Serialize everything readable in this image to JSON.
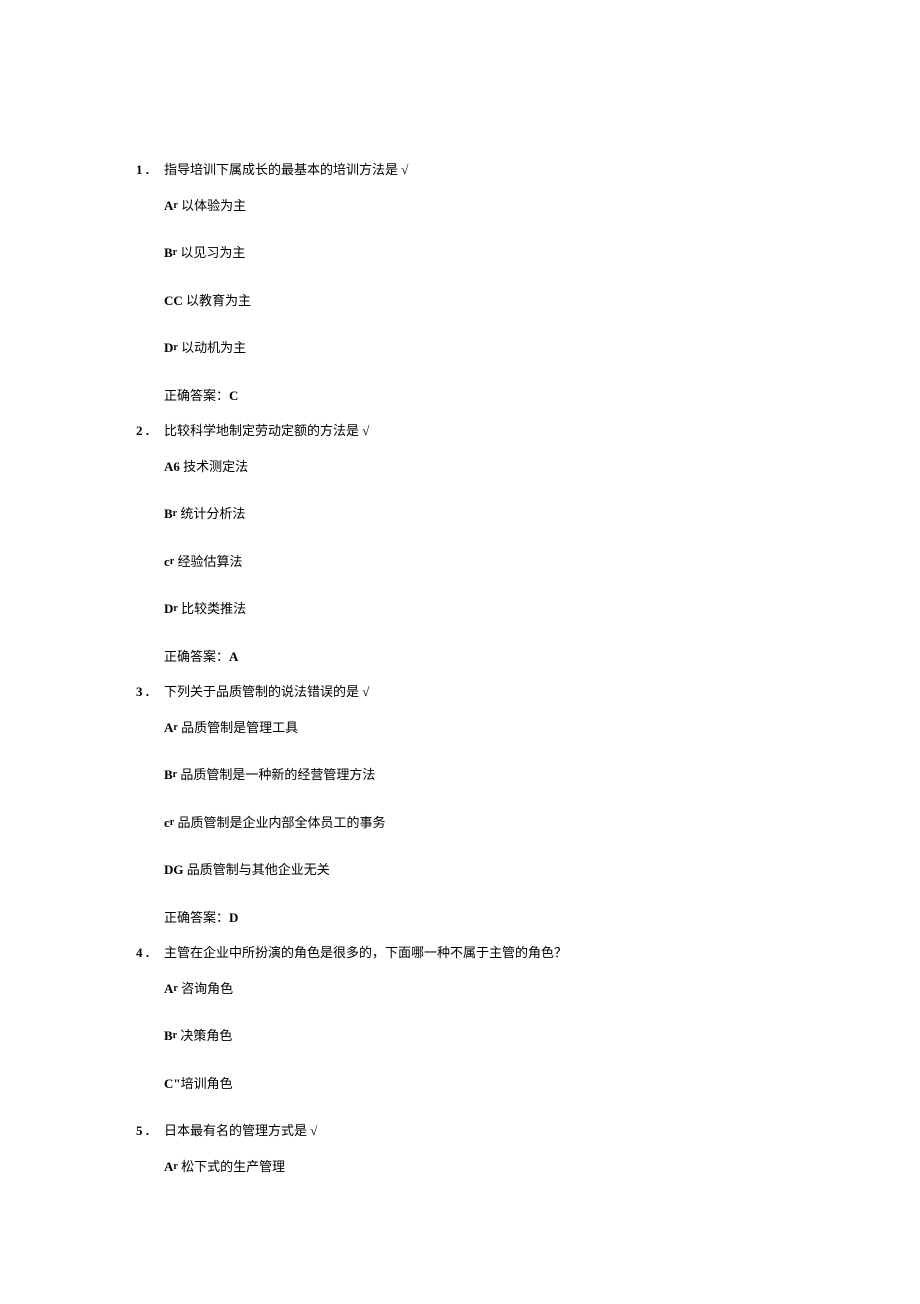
{
  "questions": [
    {
      "num": "1",
      "text": "指导培训下属成长的最基本的培训方法是 √",
      "options": [
        {
          "label": "A",
          "sup": "r",
          "text": " 以体验为主"
        },
        {
          "label": "B",
          "sup": "r",
          "text": " 以见习为主"
        },
        {
          "label": "CC",
          "sup": "",
          "text": " 以教育为主"
        },
        {
          "label": "D",
          "sup": "r",
          "text": " 以动机为主"
        }
      ],
      "answer_label": "正确答案：",
      "answer": "C"
    },
    {
      "num": "2",
      "text": "比较科学地制定劳动定额的方法是 √",
      "options": [
        {
          "label": "A6",
          "sup": "",
          "text": " 技术测定法"
        },
        {
          "label": "B",
          "sup": "r",
          "text": " 统计分析法"
        },
        {
          "label": "c",
          "sup": "r",
          "text": " 经验估算法"
        },
        {
          "label": "D",
          "sup": "r",
          "text": " 比较类推法"
        }
      ],
      "answer_label": "正确答案：",
      "answer": "A"
    },
    {
      "num": "3",
      "text": "下列关于品质管制的说法错误的是 √",
      "options": [
        {
          "label": "A",
          "sup": "r",
          "text": " 品质管制是管理工具"
        },
        {
          "label": "B",
          "sup": "r",
          "text": " 品质管制是一种新的经营管理方法"
        },
        {
          "label": "c",
          "sup": "r",
          "text": " 品质管制是企业内部全体员工的事务"
        },
        {
          "label": "DG",
          "sup": "",
          "text": " 品质管制与其他企业无关"
        }
      ],
      "answer_label": "正确答案：",
      "answer": "D"
    },
    {
      "num": "4",
      "text": "主管在企业中所扮演的角色是很多的，下面哪一种不属于主管的角色？",
      "options": [
        {
          "label": "A",
          "sup": "r",
          "text": " 咨询角色"
        },
        {
          "label": "B",
          "sup": "r",
          "text": " 决策角色"
        },
        {
          "label": "C\"",
          "sup": "",
          "text": "培训角色"
        }
      ],
      "answer_label": "",
      "answer": ""
    },
    {
      "num": "5",
      "text": "日本最有名的管理方式是 √",
      "options": [
        {
          "label": "A",
          "sup": "r",
          "text": " 松下式的生产管理"
        }
      ],
      "answer_label": "",
      "answer": ""
    }
  ]
}
